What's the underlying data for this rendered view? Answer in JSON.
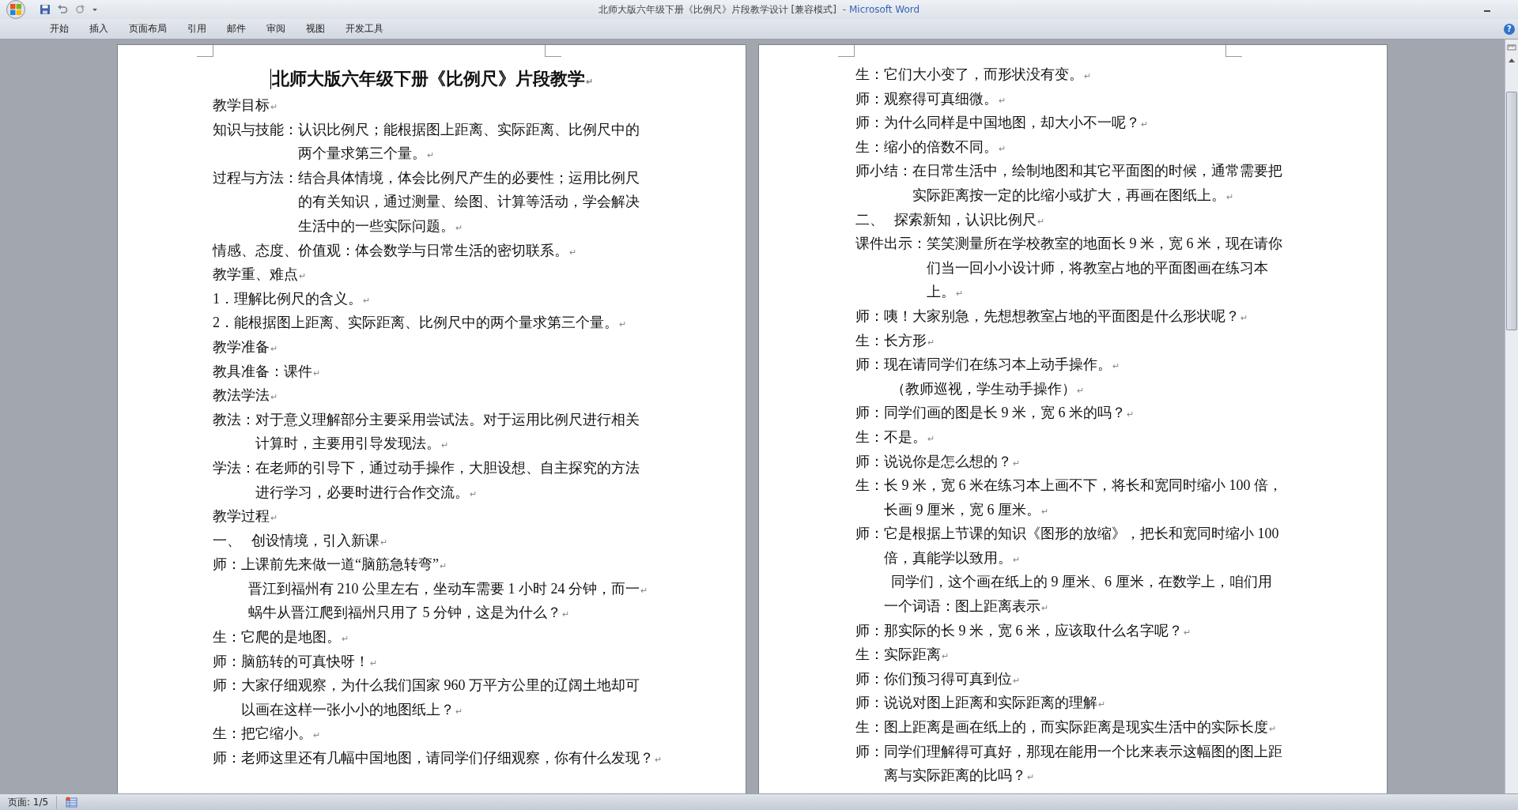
{
  "window": {
    "title": "北师大版六年级下册《比例尺》片段教学设计 [兼容模式]",
    "app_name": "- Microsoft Word"
  },
  "ribbon_tabs": [
    "开始",
    "插入",
    "页面布局",
    "引用",
    "邮件",
    "审阅",
    "视图",
    "开发工具"
  ],
  "help_button": "?",
  "pages": [
    {
      "paragraphs": [
        {
          "kind": "title",
          "lines": [
            "北师大版六年级下册《比例尺》片段教学"
          ],
          "mark": "↵"
        },
        {
          "kind": "plain",
          "lines": [
            "教学目标"
          ],
          "mark": "↵"
        },
        {
          "kind": "labeled",
          "label": "知识与技能：",
          "lines": [
            "认识比例尺；能根据图上距离、实际距离、比例尺中的",
            "两个量求第三个量。"
          ],
          "mark": "↵"
        },
        {
          "kind": "labeled",
          "label": "过程与方法：",
          "lines": [
            "结合具体情境，体会比例尺产生的必要性；运用比例尺",
            "的有关知识，通过测量、绘图、计算等活动，学会解决",
            "生活中的一些实际问题。"
          ],
          "mark": "↵"
        },
        {
          "kind": "plain",
          "lines": [
            "情感、态度、价值观：体会数学与日常生活的密切联系。"
          ],
          "mark": "↵"
        },
        {
          "kind": "plain",
          "lines": [
            "教学重、难点"
          ],
          "mark": "↵"
        },
        {
          "kind": "plain",
          "lines": [
            "1．理解比例尺的含义。"
          ],
          "mark": "↵"
        },
        {
          "kind": "plain",
          "lines": [
            "2．能根据图上距离、实际距离、比例尺中的两个量求第三个量。"
          ],
          "mark": "↵"
        },
        {
          "kind": "plain",
          "lines": [
            "教学准备"
          ],
          "mark": "↵"
        },
        {
          "kind": "plain",
          "lines": [
            "教具准备：课件"
          ],
          "mark": "↵"
        },
        {
          "kind": "plain",
          "lines": [
            "教法学法"
          ],
          "mark": "↵"
        },
        {
          "kind": "labeled",
          "label": "教法：",
          "lines": [
            "对于意义理解部分主要采用尝试法。对于运用比例尺进行相关",
            "计算时，主要用引导发现法。"
          ],
          "mark": "↵"
        },
        {
          "kind": "labeled",
          "label": "学法：",
          "lines": [
            "在老师的引导下，通过动手操作，大胆设想、自主探究的方法",
            "进行学习，必要时进行合作交流。"
          ],
          "mark": "↵"
        },
        {
          "kind": "plain",
          "lines": [
            "教学过程"
          ],
          "mark": "↵"
        },
        {
          "kind": "section",
          "label": "一、",
          "lines": [
            "创设情境，引入新课"
          ],
          "mark": "↵"
        },
        {
          "kind": "labeled",
          "label": "师：",
          "lines": [
            "上课前先来做一道“脑筋急转弯”"
          ],
          "mark": "↵"
        },
        {
          "kind": "indented",
          "lines": [
            "晋江到福州有 210 公里左右，坐动车需要 1 小时 24 分钟，而一"
          ],
          "mark": "↵"
        },
        {
          "kind": "indented",
          "lines": [
            "蜗牛从晋江爬到福州只用了 5 分钟，这是为什么？"
          ],
          "mark": "↵"
        },
        {
          "kind": "labeled",
          "label": "生：",
          "lines": [
            "它爬的是地图。"
          ],
          "mark": "↵"
        },
        {
          "kind": "labeled",
          "label": "师：",
          "lines": [
            "脑筋转的可真快呀！"
          ],
          "mark": "↵"
        },
        {
          "kind": "labeled",
          "label": "师：",
          "lines": [
            "大家仔细观察，为什么我们国家 960 万平方公里的辽阔土地却可",
            "以画在这样一张小小的地图纸上？"
          ],
          "mark": "↵"
        },
        {
          "kind": "labeled",
          "label": "生：",
          "lines": [
            "把它缩小。"
          ],
          "mark": "↵"
        },
        {
          "kind": "labeled",
          "label": "师：",
          "lines": [
            "老师这里还有几幅中国地图，请同学们仔细观察，你有什么发现？"
          ],
          "mark": "↵"
        }
      ]
    },
    {
      "paragraphs": [
        {
          "kind": "labeled",
          "label": "生：",
          "lines": [
            "它们大小变了，而形状没有变。"
          ],
          "mark": "↵"
        },
        {
          "kind": "labeled",
          "label": "师：",
          "lines": [
            "观察得可真细微。"
          ],
          "mark": "↵"
        },
        {
          "kind": "labeled",
          "label": "师：",
          "lines": [
            "为什么同样是中国地图，却大小不一呢？"
          ],
          "mark": "↵"
        },
        {
          "kind": "labeled",
          "label": "生：",
          "lines": [
            "缩小的倍数不同。"
          ],
          "mark": "↵"
        },
        {
          "kind": "labeled",
          "label": "师小结：",
          "lines": [
            "在日常生活中，绘制地图和其它平面图的时候，通常需要把",
            "实际距离按一定的比缩小或扩大，再画在图纸上。"
          ],
          "mark": "↵"
        },
        {
          "kind": "section",
          "label": "二、",
          "lines": [
            "探索新知，认识比例尺"
          ],
          "mark": "↵"
        },
        {
          "kind": "labeled",
          "label": "课件出示：",
          "lines": [
            "笑笑测量所在学校教室的地面长 9 米，宽 6 米，现在请你",
            "们当一回小小设计师，将教室占地的平面图画在练习本",
            "上。"
          ],
          "mark": "↵"
        },
        {
          "kind": "labeled",
          "label": "师：",
          "lines": [
            "咦！大家别急，先想想教室占地的平面图是什么形状呢？"
          ],
          "mark": "↵"
        },
        {
          "kind": "labeled",
          "label": "生：",
          "lines": [
            "长方形"
          ],
          "mark": "↵"
        },
        {
          "kind": "labeled",
          "label": "师：",
          "lines": [
            "现在请同学们在练习本上动手操作。"
          ],
          "mark": "↵"
        },
        {
          "kind": "indented",
          "lines": [
            "（教师巡视，学生动手操作）"
          ],
          "mark": "↵"
        },
        {
          "kind": "labeled",
          "label": "师：",
          "lines": [
            "同学们画的图是长 9 米，宽 6 米的吗？"
          ],
          "mark": "↵"
        },
        {
          "kind": "labeled",
          "label": "生：",
          "lines": [
            "不是。"
          ],
          "mark": "↵"
        },
        {
          "kind": "labeled",
          "label": "师：",
          "lines": [
            "说说你是怎么想的？"
          ],
          "mark": "↵"
        },
        {
          "kind": "labeled",
          "label": "生：",
          "lines": [
            "长 9 米，宽 6 米在练习本上画不下，将长和宽同时缩小 100 倍，",
            "长画 9 厘米，宽 6 厘米。"
          ],
          "mark": "↵"
        },
        {
          "kind": "labeled",
          "label": "师：",
          "lines": [
            "它是根据上节课的知识《图形的放缩》，把长和宽同时缩小 100",
            "倍，真能学以致用。"
          ],
          "mark": "↵"
        },
        {
          "kind": "indented",
          "lines": [
            "同学们，这个画在纸上的 9 厘米、6 厘米，在数学上，咱们用",
            "一个词语：图上距离表示"
          ],
          "mark": "↵"
        },
        {
          "kind": "labeled",
          "label": "师：",
          "lines": [
            "那实际的长 9 米，宽 6 米，应该取什么名字呢？"
          ],
          "mark": "↵"
        },
        {
          "kind": "labeled",
          "label": "生：",
          "lines": [
            "实际距离"
          ],
          "mark": "↵"
        },
        {
          "kind": "labeled",
          "label": "师：",
          "lines": [
            "你们预习得可真到位"
          ],
          "mark": "↵"
        },
        {
          "kind": "labeled",
          "label": "师：",
          "lines": [
            "说说对图上距离和实际距离的理解"
          ],
          "mark": "↵"
        },
        {
          "kind": "labeled",
          "label": "生：",
          "lines": [
            "图上距离是画在纸上的，而实际距离是现实生活中的实际长度"
          ],
          "mark": "↵"
        },
        {
          "kind": "labeled",
          "label": "师：",
          "lines": [
            "同学们理解得可真好，那现在能用一个比来表示这幅图的图上距",
            "离与实际距离的比吗？"
          ],
          "mark": "↵"
        }
      ]
    }
  ],
  "status_bar": {
    "page": "页面: 1/5"
  }
}
